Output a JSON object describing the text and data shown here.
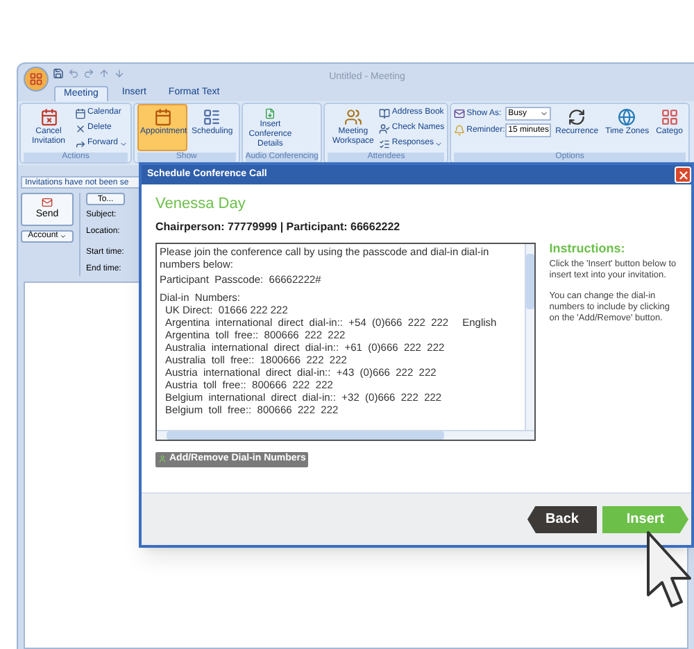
{
  "window": {
    "title": "Untitled - Meeting"
  },
  "ribbon_tabs": [
    {
      "label": "Meeting",
      "selected": true
    },
    {
      "label": "Insert",
      "selected": false
    },
    {
      "label": "Format Text",
      "selected": false
    }
  ],
  "ribbon_groups": [
    {
      "label": "Actions",
      "buttons": [
        {
          "kind": "large",
          "label": "Cancel Invitation",
          "selected": false
        },
        {
          "kind": "small",
          "label": "Calendar",
          "menu": false
        },
        {
          "kind": "small",
          "label": "Delete",
          "menu": false
        },
        {
          "kind": "small",
          "label": "Forward",
          "menu": true
        }
      ]
    },
    {
      "label": "Show",
      "buttons": [
        {
          "kind": "large",
          "label": "Appointment",
          "selected": true
        },
        {
          "kind": "large",
          "label": "Scheduling",
          "selected": false
        }
      ]
    },
    {
      "label": "Audio Conferencing",
      "buttons": [
        {
          "kind": "large",
          "label": "Insert Conference Details",
          "selected": false
        }
      ]
    },
    {
      "label": "Attendees",
      "buttons": [
        {
          "kind": "large",
          "label": "Meeting Workspace",
          "selected": false
        },
        {
          "kind": "small",
          "label": "Address Book",
          "menu": false
        },
        {
          "kind": "small",
          "label": "Check Names",
          "menu": false
        },
        {
          "kind": "small",
          "label": "Responses",
          "menu": true
        }
      ]
    },
    {
      "label": "Options",
      "buttons": [
        {
          "kind": "select",
          "label": "Show As:",
          "value": "Busy"
        },
        {
          "kind": "select",
          "label": "Reminder:",
          "value": "15 minutes"
        },
        {
          "kind": "large",
          "label": "Recurrence"
        },
        {
          "kind": "large",
          "label": "Time Zones"
        },
        {
          "kind": "large",
          "label": "Catego"
        }
      ]
    }
  ],
  "info_bar": "Invitations have not been se",
  "send_button": "Send",
  "account_button": "Account",
  "fields": [
    {
      "kind": "button",
      "label": "To..."
    },
    {
      "kind": "label",
      "label": "Subject:"
    },
    {
      "kind": "label",
      "label": "Location:"
    },
    {
      "kind": "label",
      "label": "Start time:"
    },
    {
      "kind": "label",
      "label": "End time:"
    }
  ],
  "dialog": {
    "title": "Schedule Conference Call",
    "name": "Venessa Day",
    "codes": "Chairperson: 77779999 | Participant: 66662222",
    "message": {
      "intro": "Please join the conference call by using the passcode and dial-in dial-in numbers below:",
      "passcode": "Participant  Passcode:  66662222#",
      "heading": "Dial-in  Numbers:",
      "numbers": [
        {
          "text": "UK Direct:  01666 222 222"
        },
        {
          "text": "Argentina  international  direct  dial-in::  +54  (0)666  222  222",
          "language": "English"
        },
        {
          "text": "Argentina  toll  free::  800666  222  222"
        },
        {
          "text": "Australia  international  direct  dial-in::  +61  (0)666  222  222"
        },
        {
          "text": "Australia  toll  free::  1800666  222  222"
        },
        {
          "text": "Austria  international  direct  dial-in::  +43  (0)666  222  222"
        },
        {
          "text": "Austria  toll  free::  800666  222  222"
        },
        {
          "text": "Belgium  international  direct  dial-in::  +32  (0)666  222  222"
        },
        {
          "text": "Belgium  toll  free::  800666  222  222"
        }
      ]
    },
    "instructions_title": "Instructions:",
    "instructions": [
      "Click the 'Insert' button below to insert text into your invitation.",
      "You can change the dial-in numbers to include by clicking on the 'Add/Remove' button."
    ],
    "add_remove_button": "Add/Remove Dial-in Numbers",
    "back_button": "Back",
    "insert_button": "Insert"
  }
}
